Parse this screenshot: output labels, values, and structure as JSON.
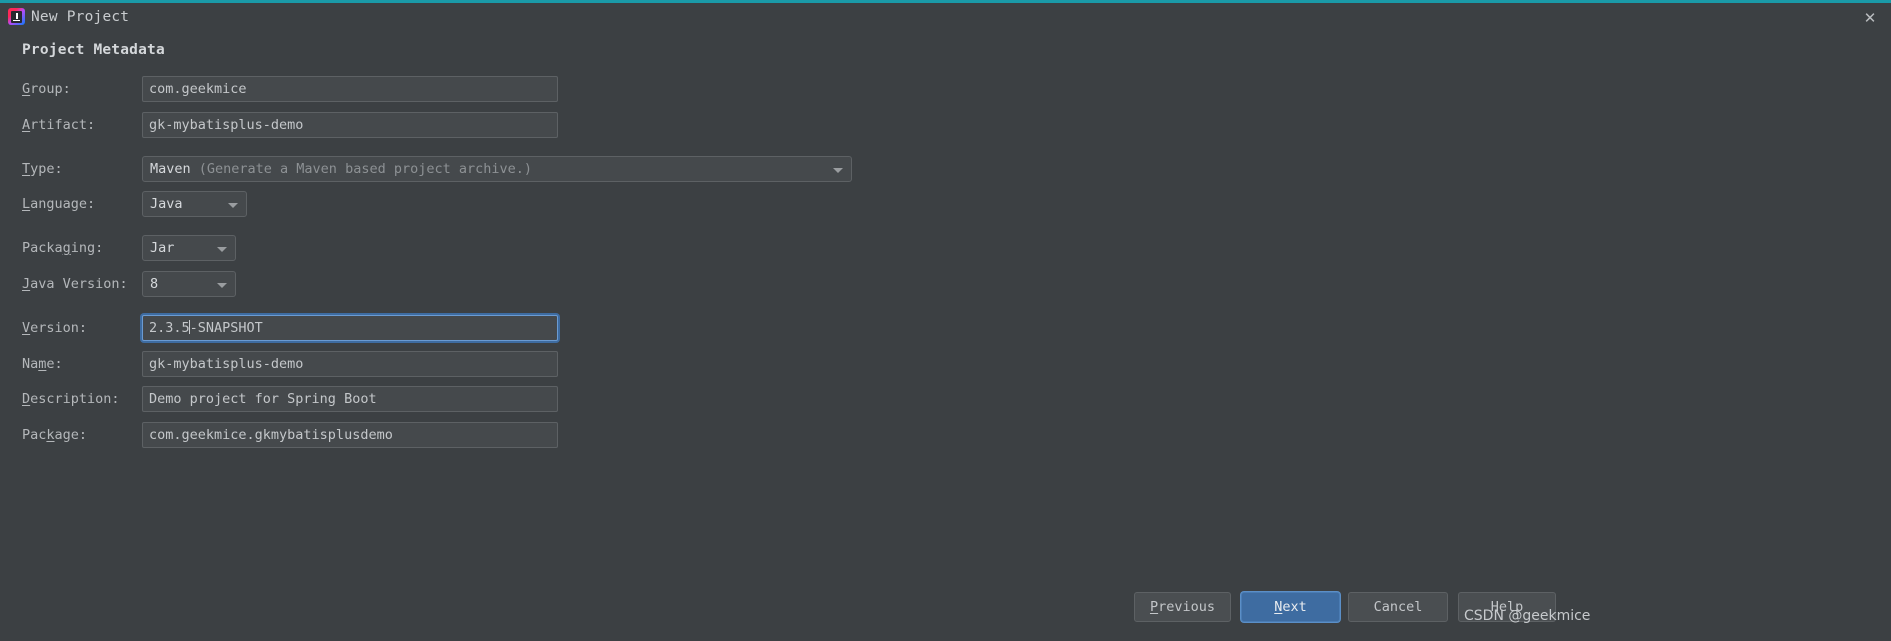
{
  "window": {
    "title": "New Project",
    "logo_icon": "intellij-idea-logo",
    "close_icon": "close-icon",
    "accent_color": "#1a9aa8"
  },
  "section": {
    "heading": "Project Metadata"
  },
  "form": {
    "rows": [
      {
        "id": "group",
        "label_pre": "",
        "label_mn": "G",
        "label_post": "roup:",
        "kind": "text",
        "value": "com.geekmice",
        "focused": false
      },
      {
        "id": "artifact",
        "label_pre": "",
        "label_mn": "A",
        "label_post": "rtifact:",
        "kind": "text",
        "value": "gk-mybatisplus-demo",
        "focused": false
      },
      {
        "id": "type",
        "label_pre": "",
        "label_mn": "T",
        "label_post": "ype:",
        "kind": "combo",
        "value": "Maven",
        "value_secondary": "(Generate a Maven based project archive.)"
      },
      {
        "id": "language",
        "label_pre": "",
        "label_mn": "L",
        "label_post": "anguage:",
        "kind": "combo",
        "value": "Java"
      },
      {
        "id": "packaging",
        "label_pre": "Packa",
        "label_mn": "g",
        "label_post": "ing:",
        "kind": "combo",
        "value": "Jar"
      },
      {
        "id": "java-version",
        "label_pre": "",
        "label_mn": "J",
        "label_post": "ava Version:",
        "kind": "combo",
        "value": "8"
      },
      {
        "id": "version",
        "label_pre": "",
        "label_mn": "V",
        "label_post": "ersion:",
        "kind": "text",
        "value_before_caret": "2.3.5",
        "value_after_caret": "-SNAPSHOT",
        "focused": true
      },
      {
        "id": "name",
        "label_pre": "Na",
        "label_mn": "m",
        "label_post": "e:",
        "kind": "text",
        "value": "gk-mybatisplus-demo",
        "focused": false
      },
      {
        "id": "description",
        "label_pre": "",
        "label_mn": "D",
        "label_post": "escription:",
        "kind": "text",
        "value": "Demo project for Spring Boot",
        "focused": false
      },
      {
        "id": "package",
        "label_pre": "Pac",
        "label_mn": "k",
        "label_post": "age:",
        "kind": "text",
        "value": "com.geekmice.gkmybatisplusdemo",
        "focused": false
      }
    ]
  },
  "buttons": {
    "previous": {
      "pre": "",
      "mn": "P",
      "post": "revious"
    },
    "next": {
      "pre": "",
      "mn": "N",
      "post": "ext"
    },
    "cancel": {
      "pre": "Cancel",
      "mn": "",
      "post": ""
    },
    "help": {
      "pre": "Help",
      "mn": "",
      "post": ""
    }
  },
  "watermark": {
    "text": "CSDN @geekmice"
  }
}
